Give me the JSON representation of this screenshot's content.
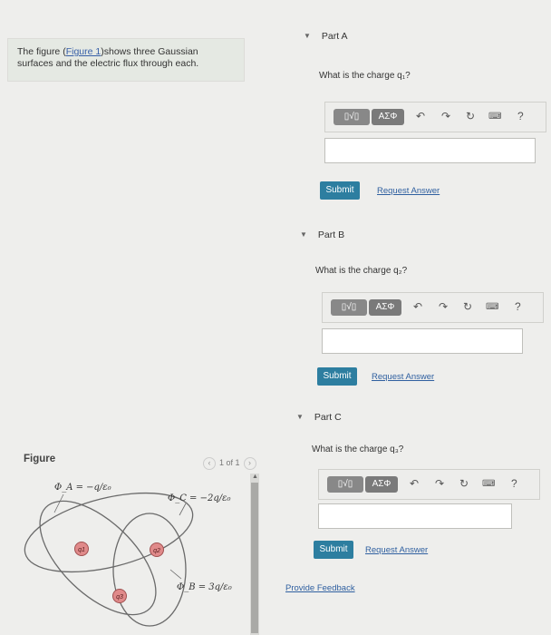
{
  "intro": {
    "text_before": "The figure (",
    "link": "Figure 1",
    "text_after": ")shows three Gaussian surfaces and the electric flux through each."
  },
  "figure": {
    "label": "Figure",
    "pager": "1 of 1",
    "flux_a": "Φ_A = −q/ε₀",
    "flux_c": "Φ_C = −2q/ε₀",
    "flux_b": "Φ_B = 3q/ε₀",
    "charge_1": "q1",
    "charge_2": "q2",
    "charge_3": "q3"
  },
  "parts": [
    {
      "label": "Part A",
      "question": "What is the charge q₁?",
      "submit": "Submit",
      "request": "Request Answer"
    },
    {
      "label": "Part B",
      "question": "What is the charge q₂?",
      "submit": "Submit",
      "request": "Request Answer"
    },
    {
      "label": "Part C",
      "question": "What is the charge q₃?",
      "submit": "Submit",
      "request": "Request Answer"
    }
  ],
  "toolbar": {
    "templates_label": "▯√▯",
    "symbols_label": "AΣΦ",
    "help": "?"
  },
  "feedback": "Provide Feedback",
  "colors": {
    "submit": "#2d7ea0",
    "link": "#3060a0",
    "charge_fill": "#e08a8a"
  }
}
